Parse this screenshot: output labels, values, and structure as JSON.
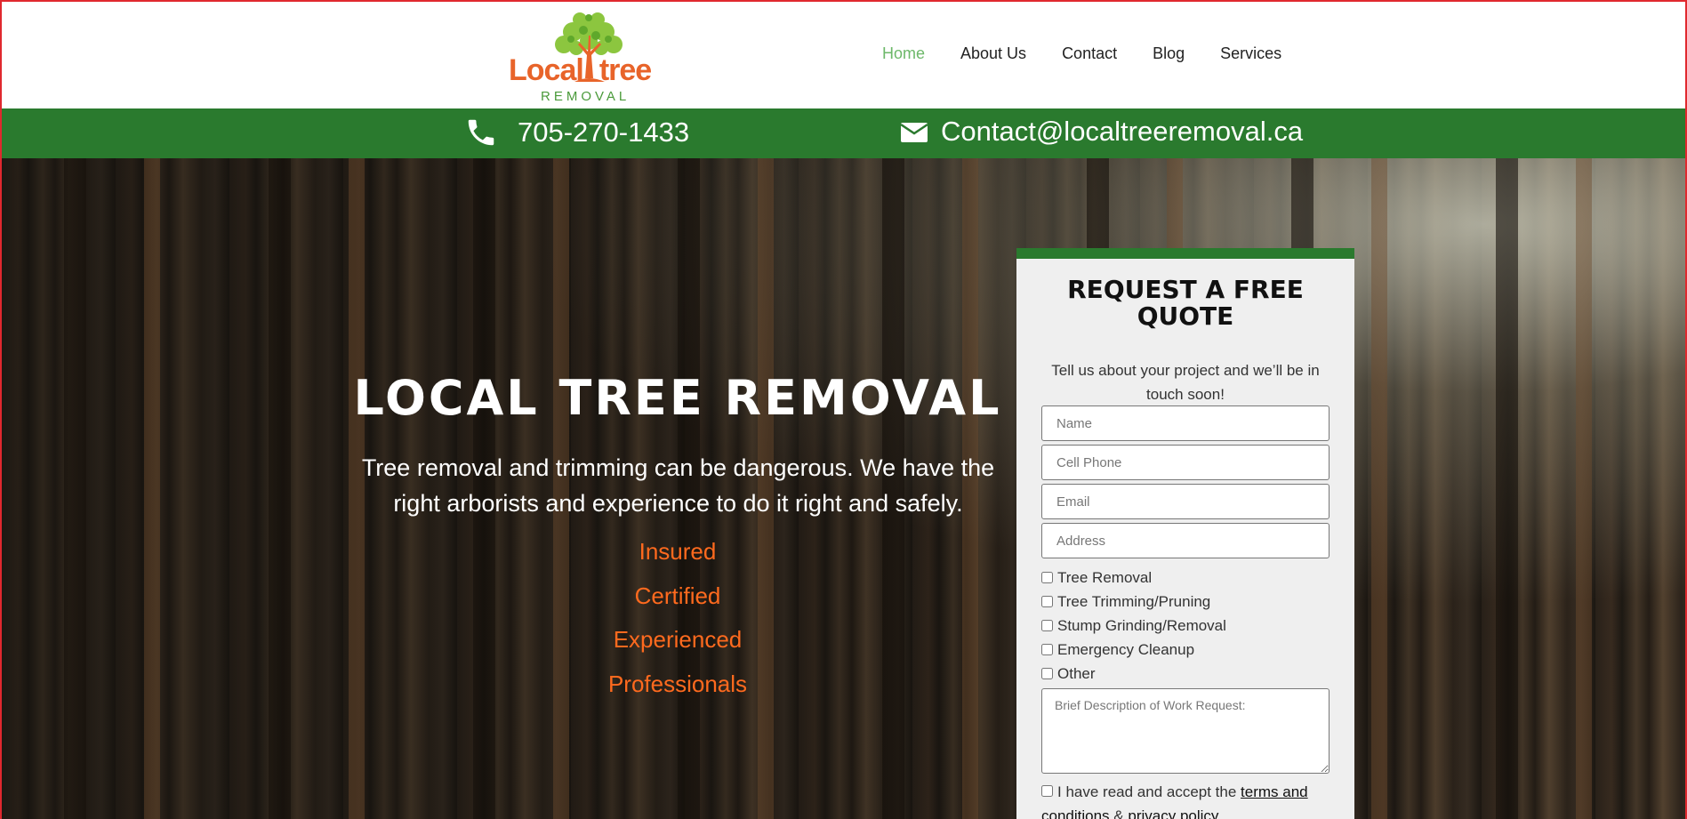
{
  "header": {
    "logo": {
      "word_left": "Local",
      "word_right": "tree",
      "sub": "REMOVAL"
    },
    "nav": [
      {
        "label": "Home",
        "active": true
      },
      {
        "label": "About Us",
        "active": false
      },
      {
        "label": "Contact",
        "active": false
      },
      {
        "label": "Blog",
        "active": false
      },
      {
        "label": "Services",
        "active": false
      }
    ]
  },
  "contact_bar": {
    "phone": "705-270-1433",
    "email": "Contact@localtreeremoval.ca",
    "phone_icon": "phone-icon",
    "mail_icon": "envelope-icon"
  },
  "hero": {
    "title": "LOCAL TREE REMOVAL",
    "text": "Tree removal and trimming can be dangerous. We have the right arborists and experience to do it right and safely.",
    "highlights": [
      "Insured",
      "Certified",
      "Experienced",
      "Professionals"
    ]
  },
  "quote_form": {
    "title": "REQUEST A FREE QUOTE",
    "subtitle": "Tell us about your project and we’ll be in touch soon!",
    "fields": {
      "name_placeholder": "Name",
      "phone_placeholder": "Cell Phone",
      "email_placeholder": "Email",
      "address_placeholder": "Address",
      "description_placeholder": "Brief Description of Work Request:"
    },
    "services": [
      "Tree Removal",
      "Tree Trimming/Pruning",
      "Stump Grinding/Removal",
      "Emergency Cleanup",
      "Other"
    ],
    "terms": {
      "prefix": "I have read and accept the",
      "terms_link": "terms and conditions",
      "and": "&",
      "privacy_link": "privacy policy"
    }
  },
  "colors": {
    "brand_green": "#2a7a2e",
    "brand_orange": "#e8642a",
    "highlight_orange": "#ff6a1e",
    "nav_active": "#6db86a"
  }
}
